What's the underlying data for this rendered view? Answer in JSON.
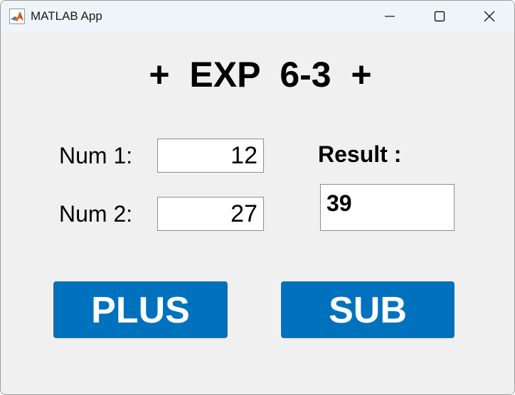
{
  "window": {
    "title": "MATLAB App",
    "icon": "matlab-logo-icon",
    "controls": [
      "minimize-icon",
      "maximize-icon",
      "close-icon"
    ]
  },
  "app": {
    "heading": "+  EXP  6-3  +"
  },
  "inputs": {
    "num1_label": "Num 1:",
    "num1_value": "12",
    "num2_label": "Num 2:",
    "num2_value": "27"
  },
  "result": {
    "label": "Result :",
    "value": "39"
  },
  "buttons": {
    "plus_label": "PLUS",
    "sub_label": "SUB"
  },
  "colors": {
    "button_bg": "#0072bd",
    "button_text": "#ffffff",
    "panel_bg": "#f0f0f0",
    "titlebar_bg": "#eef4f7"
  }
}
